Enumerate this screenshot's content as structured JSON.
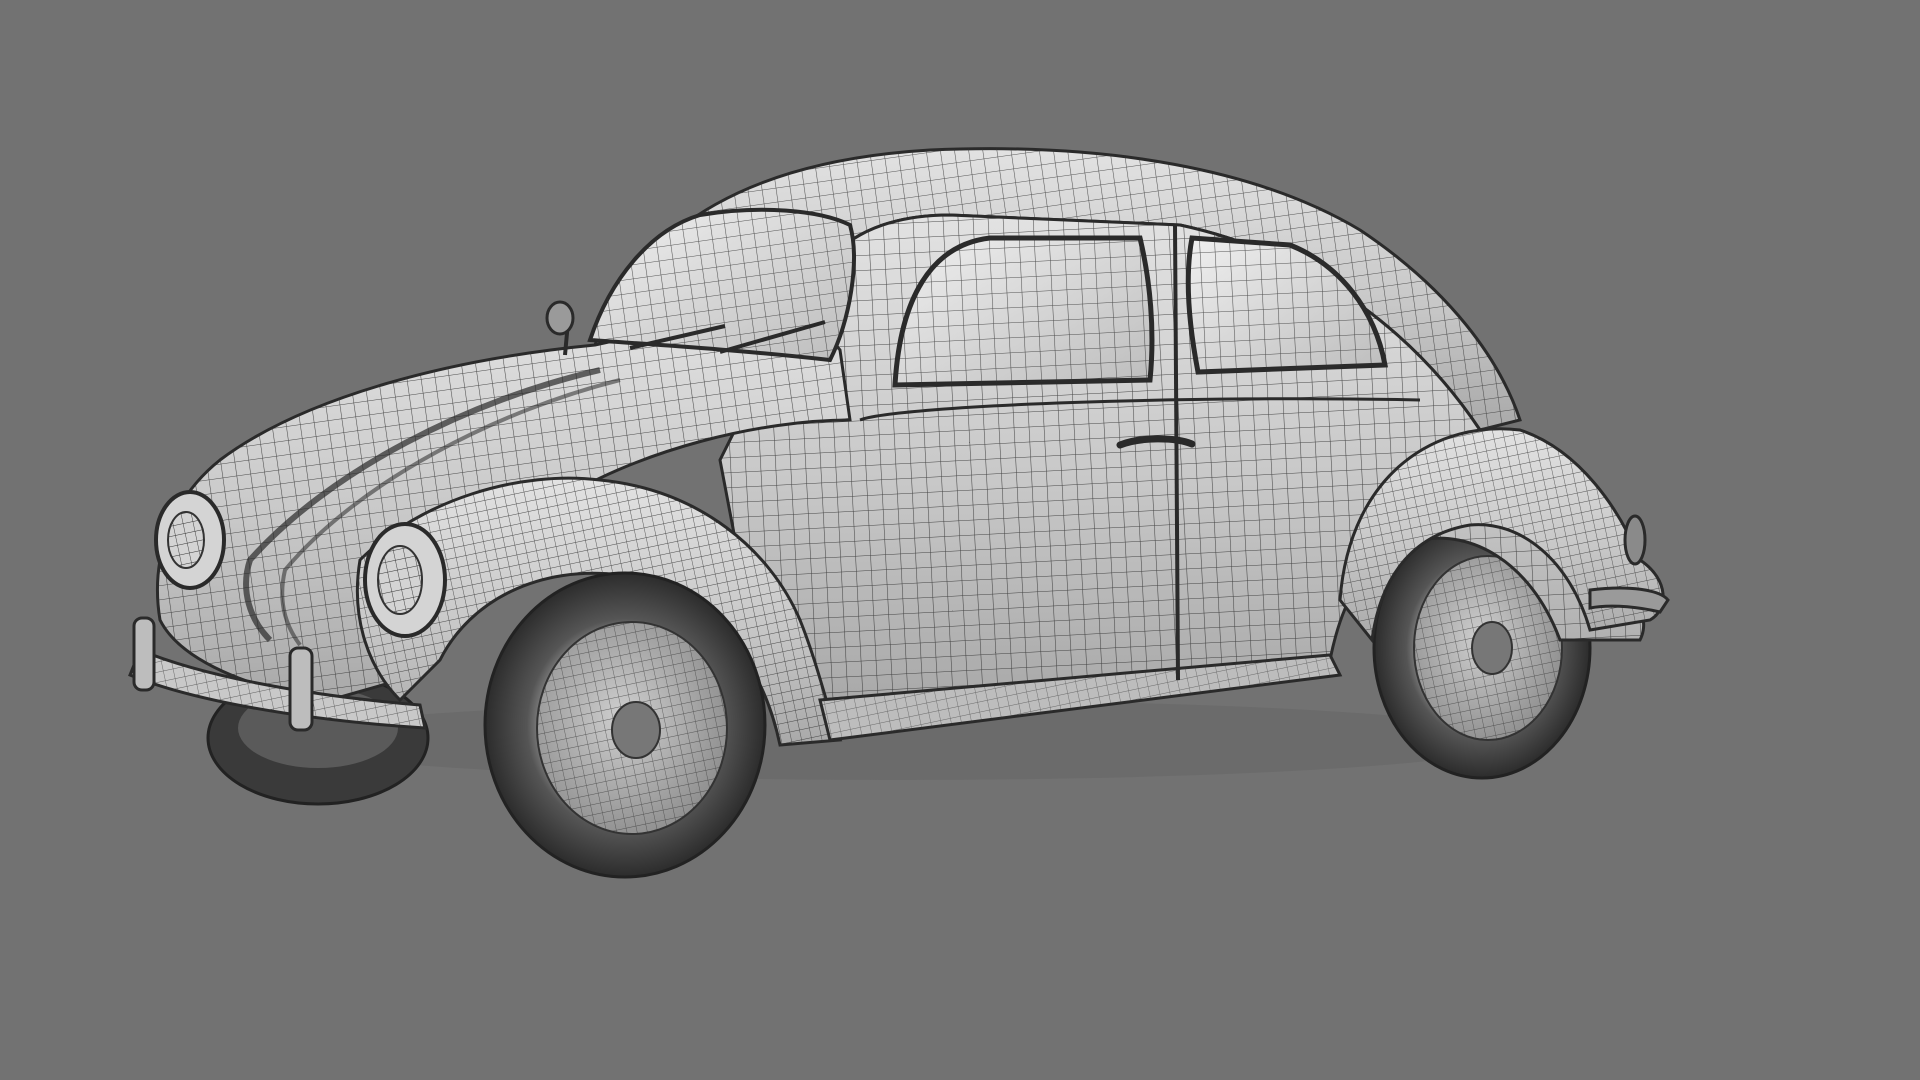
{
  "scene": {
    "subject": "car-wireframe-render",
    "colors": {
      "background": "#727272",
      "body_fill": "#cfcfcf",
      "body_shade": "#a8a8a8",
      "wire": "#2e2e2e",
      "tire": "#3a3a3a",
      "glass": "#d9d9d9"
    },
    "visible_text": []
  }
}
